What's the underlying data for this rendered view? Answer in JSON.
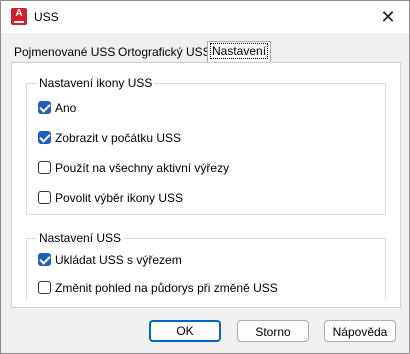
{
  "window": {
    "title": "USS",
    "app_icon_letter": "A",
    "close_glyph": "✕"
  },
  "tabs": [
    {
      "label": "Pojmenované USS",
      "active": false
    },
    {
      "label": "Ortografický USS",
      "active": false
    },
    {
      "label": "Nastavení",
      "active": true
    }
  ],
  "group_icon": {
    "title": "Nastavení ikony USS",
    "items": [
      {
        "label": "Ano",
        "checked": true
      },
      {
        "label": "Zobrazit v počátku USS",
        "checked": true
      },
      {
        "label": "Použít na všechny aktivní výřezy",
        "checked": false
      },
      {
        "label": "Povolit výběr ikony USS",
        "checked": false
      }
    ]
  },
  "group_uss": {
    "title": "Nastavení USS",
    "items": [
      {
        "label": "Ukládat USS s výřezem",
        "checked": true
      },
      {
        "label": "Změnit pohled na půdorys při změně USS",
        "checked": false
      }
    ]
  },
  "buttons": {
    "ok": "OK",
    "cancel": "Storno",
    "help": "Nápověda"
  },
  "colors": {
    "accent": "#1f5fbf",
    "app_icon": "#d41e2c",
    "default_button_border": "#0067c0"
  }
}
